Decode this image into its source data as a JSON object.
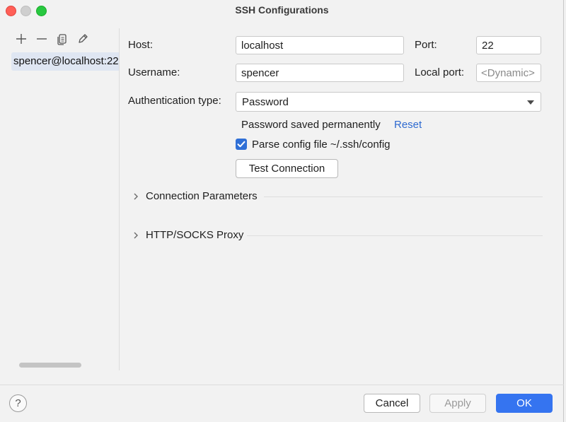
{
  "window": {
    "title": "SSH Configurations"
  },
  "toolbar": {
    "add_icon": "plus-icon",
    "remove_icon": "minus-icon",
    "copy_icon": "copy-icon",
    "edit_icon": "pencil-icon"
  },
  "configs": {
    "items": [
      {
        "label": "spencer@localhost:22"
      }
    ]
  },
  "form": {
    "host_label": "Host:",
    "host_value": "localhost",
    "port_label": "Port:",
    "port_value": "22",
    "username_label": "Username:",
    "username_value": "spencer",
    "local_port_label": "Local port:",
    "local_port_placeholder": "<Dynamic>",
    "auth_label": "Authentication type:",
    "auth_value": "Password",
    "password_status": "Password saved permanently",
    "reset_link": "Reset",
    "parse_config_label": "Parse config file ~/.ssh/config",
    "parse_config_checked": true,
    "test_connection": "Test Connection"
  },
  "sections": [
    {
      "label": "Connection Parameters"
    },
    {
      "label": "HTTP/SOCKS Proxy"
    }
  ],
  "footer": {
    "help": "?",
    "cancel": "Cancel",
    "apply": "Apply",
    "ok": "OK"
  },
  "colors": {
    "accent": "#3574f0",
    "link": "#2e6ad0",
    "selection": "#dfe6f2"
  }
}
